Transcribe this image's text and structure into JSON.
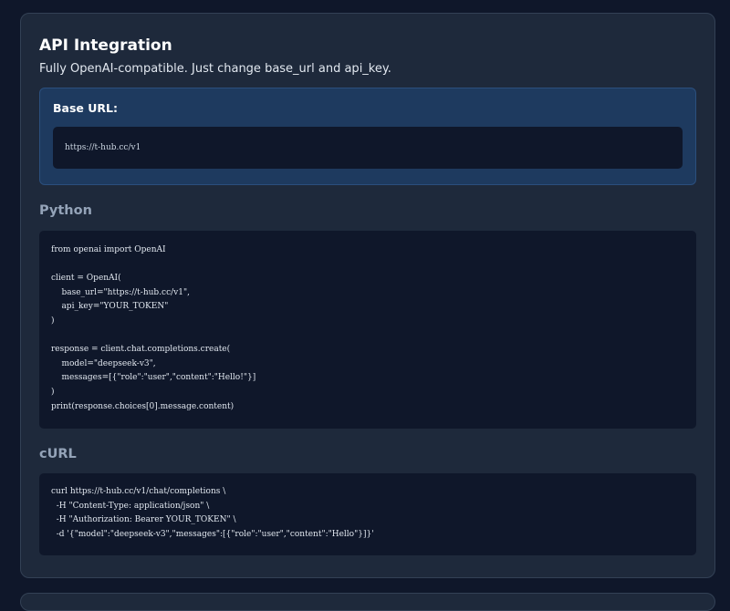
{
  "api": {
    "title": "API Integration",
    "subtitle": "Fully OpenAI-compatible. Just change base_url and api_key.",
    "base_url_label": "Base URL:",
    "base_url": "https://t-hub.cc/v1"
  },
  "python": {
    "heading": "Python",
    "code": "from openai import OpenAI\n\nclient = OpenAI(\n    base_url=\"https://t-hub.cc/v1\",\n    api_key=\"YOUR_TOKEN\"\n)\n\nresponse = client.chat.completions.create(\n    model=\"deepseek-v3\",\n    messages=[{\"role\":\"user\",\"content\":\"Hello!\"}]\n)\nprint(response.choices[0].message.content)"
  },
  "curl": {
    "heading": "cURL",
    "code": "curl https://t-hub.cc/v1/chat/completions \\\n  -H \"Content-Type: application/json\" \\\n  -H \"Authorization: Bearer YOUR_TOKEN\" \\\n  -d '{\"model\":\"deepseek-v3\",\"messages\":[{\"role\":\"user\",\"content\":\"Hello\"}]}'"
  },
  "colors": {
    "page_bg": "#0f172a",
    "card_bg": "#1e293b",
    "base_box_bg": "#1e3a5f",
    "code_bg": "#0f172a",
    "heading_muted": "#94a3b8"
  }
}
